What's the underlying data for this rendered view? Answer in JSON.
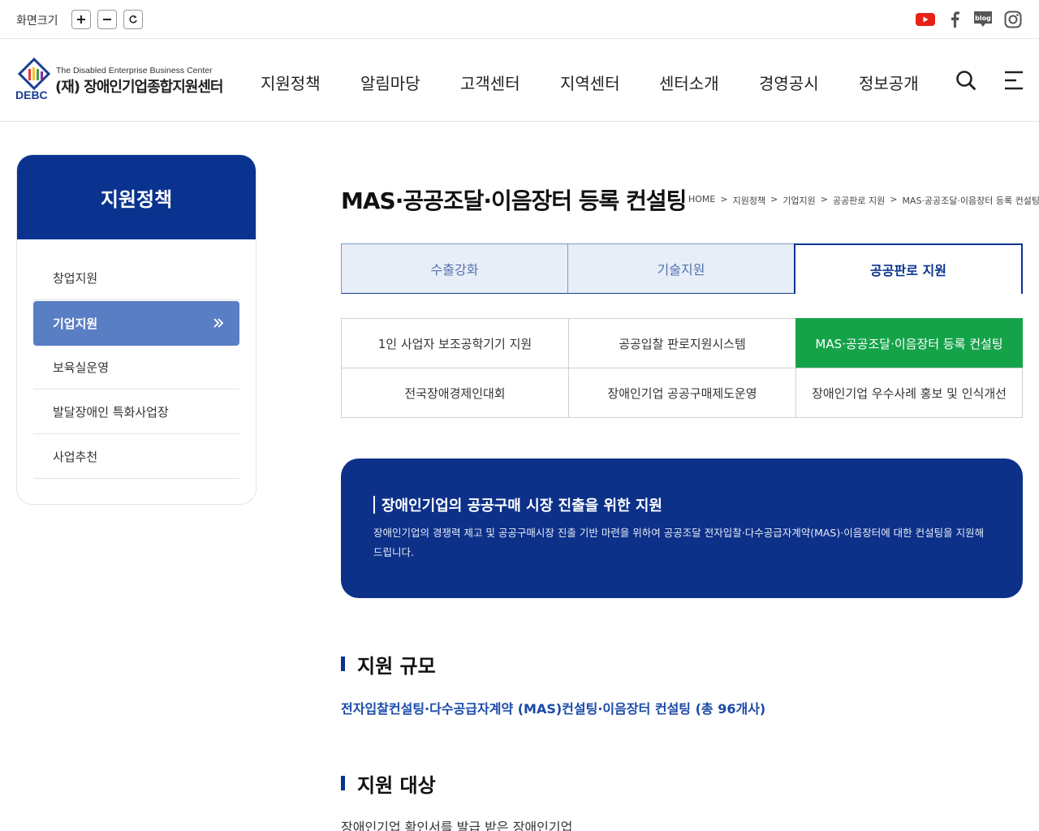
{
  "topbar": {
    "zoom_label": "화면크기",
    "zoom_in": "+",
    "zoom_out": "−",
    "social": [
      "youtube-icon",
      "facebook-icon",
      "blog-icon",
      "instagram-icon"
    ],
    "blog_text": "blog"
  },
  "logo": {
    "en": "The Disabled Enterprise Business Center",
    "ko": "(재) 장애인기업종합지원센터",
    "abbr": "DEBC"
  },
  "gnb": [
    "지원정책",
    "알림마당",
    "고객센터",
    "지역센터",
    "센터소개",
    "경영공시",
    "정보공개"
  ],
  "sidebar": {
    "title": "지원정책",
    "items": [
      {
        "label": "창업지원",
        "active": false
      },
      {
        "label": "기업지원",
        "active": true
      },
      {
        "label": "보육실운영",
        "active": false
      },
      {
        "label": "발달장애인 특화사업장",
        "active": false
      },
      {
        "label": "사업추천",
        "active": false
      }
    ]
  },
  "page": {
    "title": "MAS·공공조달·이음장터 등록 컨설팅",
    "breadcrumb": [
      "HOME",
      "지원정책",
      "기업지원",
      "공공판로 지원",
      "MAS·공공조달·이음장터 등록 컨설팅"
    ],
    "breadcrumb_sep": ">"
  },
  "tabs": [
    {
      "label": "수출강화",
      "active": false
    },
    {
      "label": "기술지원",
      "active": false
    },
    {
      "label": "공공판로 지원",
      "active": true
    }
  ],
  "subtabs": [
    {
      "label": "1인 사업자 보조공학기기 지원",
      "active": false
    },
    {
      "label": "공공입찰 판로지원시스템",
      "active": false
    },
    {
      "label": "MAS·공공조달·이음장터 등록 컨설팅",
      "active": true
    },
    {
      "label": "전국장애경제인대회",
      "active": false
    },
    {
      "label": "장애인기업 공공구매제도운영",
      "active": false
    },
    {
      "label": "장애인기업 우수사례 홍보 및 인식개선",
      "active": false
    }
  ],
  "banner": {
    "title": "장애인기업의 공공구매 시장 진출을 위한 지원",
    "desc": "장애인기업의 경쟁력 제고 및 공공구매시장 진출 기반 마련을 위하여 공공조달 전자입찰·다수공급자계약(MAS)·이음장터에 대한 컨설팅을 지원해드립니다."
  },
  "sections": {
    "scale_title": "지원 규모",
    "scale_text": "전자입찰컨설팅·다수공급자계약 (MAS)컨설팅·이음장터 컨설팅 (총 96개사)",
    "target_title": "지원 대상",
    "target_text": "장애인기업 확인서를 발급 받은 장애인기업"
  },
  "colors": {
    "primary": "#0a3390",
    "active_side": "#5a7ec4",
    "active_sub": "#15a34a",
    "tab_bg": "#e8eef7"
  }
}
